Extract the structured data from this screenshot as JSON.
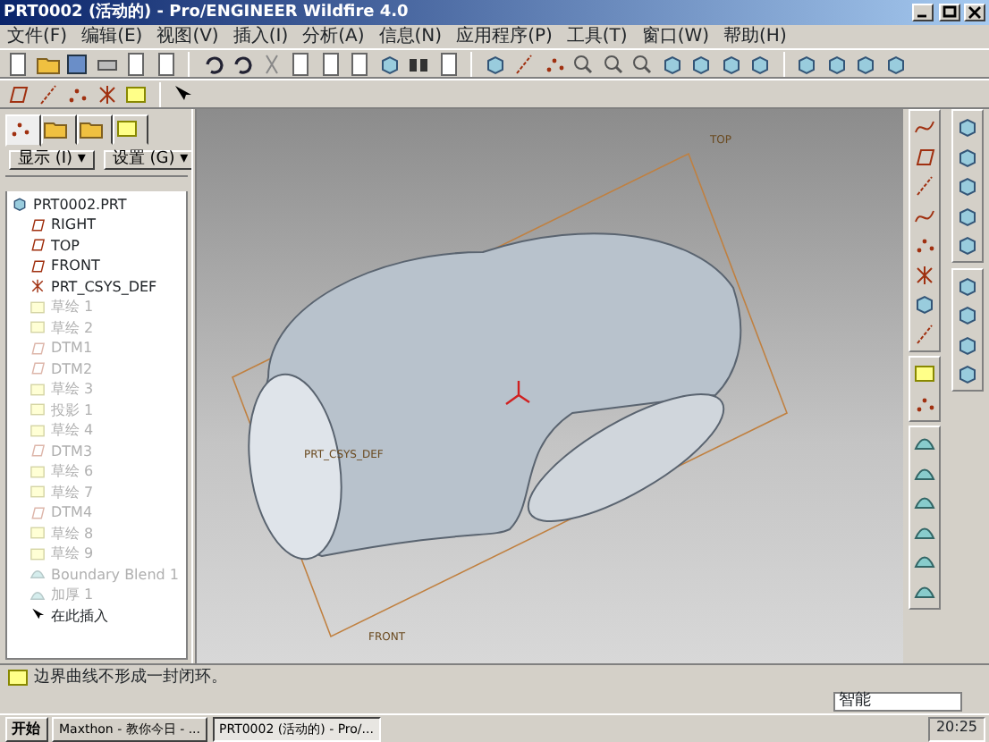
{
  "window": {
    "title": "PRT0002 (活动的) - Pro/ENGINEER Wildfire 4.0"
  },
  "menu": [
    "文件(F)",
    "编辑(E)",
    "视图(V)",
    "插入(I)",
    "分析(A)",
    "信息(N)",
    "应用程序(P)",
    "工具(T)",
    "窗口(W)",
    "帮助(H)"
  ],
  "navigator": {
    "tabs": [
      {
        "selected": true
      },
      {
        "selected": false
      },
      {
        "selected": false
      },
      {
        "selected": false
      }
    ],
    "buttons": [
      "显示 (I) ▾",
      "设置 (G) ▾"
    ],
    "tree": {
      "label": "PRT0002.PRT",
      "kind": "part",
      "children": [
        {
          "label": "RIGHT",
          "kind": "plane",
          "disabled": false
        },
        {
          "label": "TOP",
          "kind": "plane",
          "disabled": false
        },
        {
          "label": "FRONT",
          "kind": "plane",
          "disabled": false
        },
        {
          "label": "PRT_CSYS_DEF",
          "kind": "csys",
          "disabled": false
        },
        {
          "label": "草绘 1",
          "kind": "sketch",
          "disabled": true
        },
        {
          "label": "草绘 2",
          "kind": "sketch",
          "disabled": true
        },
        {
          "label": "DTM1",
          "kind": "plane",
          "disabled": true
        },
        {
          "label": "DTM2",
          "kind": "plane",
          "disabled": true
        },
        {
          "label": "草绘 3",
          "kind": "sketch",
          "disabled": true
        },
        {
          "label": "投影 1",
          "kind": "sketch",
          "disabled": true
        },
        {
          "label": "草绘 4",
          "kind": "sketch",
          "disabled": true
        },
        {
          "label": "DTM3",
          "kind": "plane",
          "disabled": true
        },
        {
          "label": "草绘 6",
          "kind": "sketch",
          "disabled": true
        },
        {
          "label": "草绘 7",
          "kind": "sketch",
          "disabled": true
        },
        {
          "label": "DTM4",
          "kind": "plane",
          "disabled": true
        },
        {
          "label": "草绘 8",
          "kind": "sketch",
          "disabled": true
        },
        {
          "label": "草绘 9",
          "kind": "sketch",
          "disabled": true
        },
        {
          "label": "Boundary Blend 1",
          "kind": "feature",
          "disabled": true
        },
        {
          "label": "加厚 1",
          "kind": "feature",
          "disabled": true
        },
        {
          "label": "在此插入",
          "kind": "insert",
          "disabled": false
        }
      ]
    }
  },
  "viewport": {
    "labels": [
      {
        "text": "TOP",
        "kind": "top"
      },
      {
        "text": "PRT_CSYS_DEF",
        "kind": "csys"
      },
      {
        "text": "FRONT",
        "kind": "front"
      }
    ]
  },
  "message": "边界曲线不形成一封闭环。",
  "filter": {
    "value": "智能"
  },
  "taskbar": {
    "start": "开始",
    "tasks": [
      {
        "label": "Maxthon - 教你今日 - ...",
        "selected": false
      },
      {
        "label": "PRT0002 (活动的) - Pro/...",
        "selected": true
      }
    ],
    "clock": "20:25"
  }
}
